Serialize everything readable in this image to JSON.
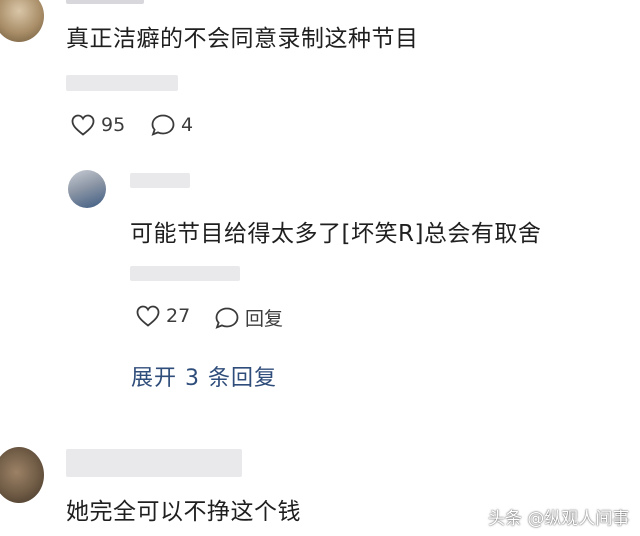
{
  "comments": [
    {
      "text": "真正洁癖的不会同意录制这种节目",
      "likes": "95",
      "replies": "4"
    },
    {
      "text": "可能节目给得太多了[坏笑R]总会有取舍",
      "likes": "27",
      "reply_label": "回复"
    },
    {
      "text": "她完全可以不挣这个钱"
    }
  ],
  "expand_label": "展开 3 条回复",
  "watermark": "头条 @纵观人间事",
  "icons": {
    "like": "heart-outline-icon",
    "comment": "speech-bubble-icon"
  }
}
